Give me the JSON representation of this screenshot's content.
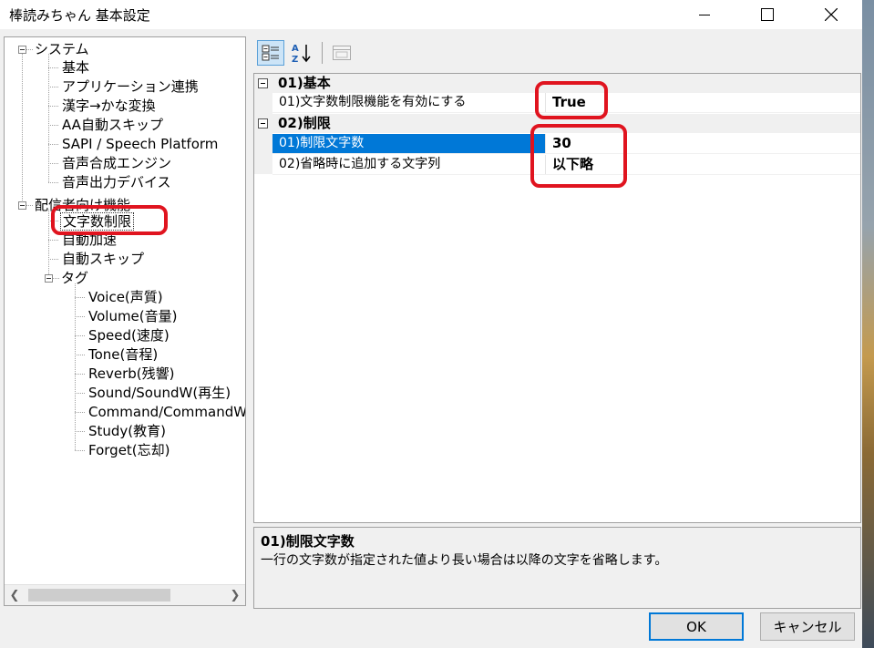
{
  "window": {
    "title": "棒読みちゃん 基本設定"
  },
  "tree": {
    "system": {
      "label": "システム",
      "children": [
        "基本",
        "アプリケーション連携",
        "漢字→かな変換",
        "AA自動スキップ",
        "SAPI / Speech Platform",
        "音声合成エンジン",
        "音声出力デバイス"
      ]
    },
    "streaming": {
      "label": "配信者向け機能",
      "children": [
        "文字数制限",
        "自動加速",
        "自動スキップ"
      ]
    },
    "tags": {
      "label": "タグ",
      "children": [
        "Voice(声質)",
        "Volume(音量)",
        "Speed(速度)",
        "Tone(音程)",
        "Reverb(残響)",
        "Sound/SoundW(再生)",
        "Command/CommandW",
        "Study(教育)",
        "Forget(忘却)"
      ]
    },
    "selected": "文字数制限"
  },
  "toolbar": {
    "categorized": "categorized-view-icon",
    "alphabetical": "sort-az-icon",
    "pages": "property-pages-icon"
  },
  "grid": {
    "categories": [
      {
        "label": "01)基本",
        "props": [
          {
            "name": "01)文字数制限機能を有効にする",
            "value": "True"
          }
        ]
      },
      {
        "label": "02)制限",
        "props": [
          {
            "name": "01)制限文字数",
            "value": "30"
          },
          {
            "name": "02)省略時に追加する文字列",
            "value": "以下略"
          }
        ]
      }
    ],
    "selected_property": "01)制限文字数"
  },
  "description": {
    "title": "01)制限文字数",
    "text": "一行の文字数が指定された値より長い場合は以降の文字を省略します。"
  },
  "buttons": {
    "ok": "OK",
    "cancel": "キャンセル"
  },
  "colors": {
    "selection": "#0078d7",
    "highlight_annotation": "#e0141f"
  }
}
